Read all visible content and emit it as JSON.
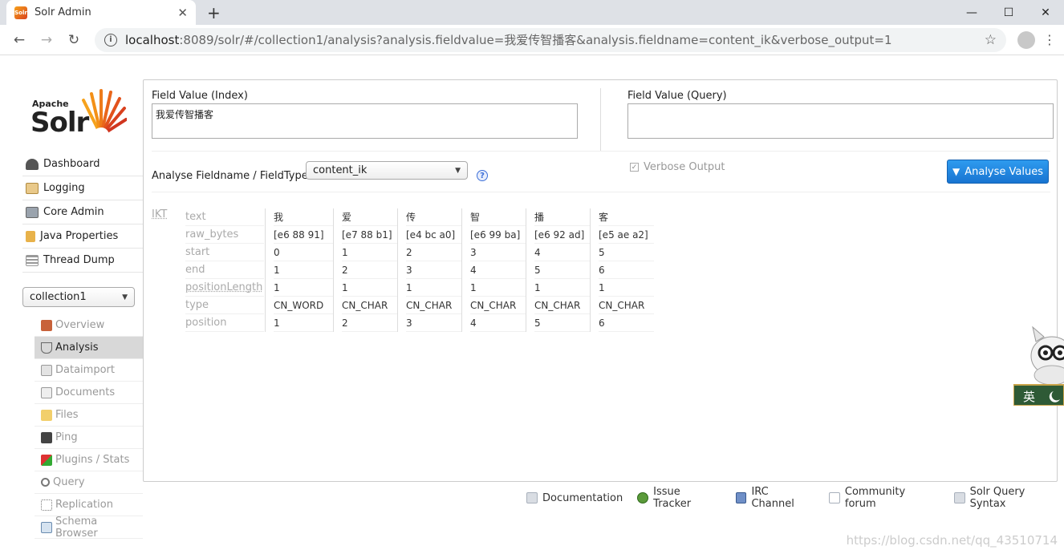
{
  "browser": {
    "tab_title": "Solr Admin",
    "favicon_text": "Solr",
    "url_host": "localhost",
    "url_rest": ":8089/solr/#/collection1/analysis?analysis.fieldvalue=我爱传智播客&analysis.fieldname=content_ik&verbose_output=1"
  },
  "logo": {
    "apache": "Apache",
    "solr": "Solr"
  },
  "nav": {
    "items": [
      {
        "label": "Dashboard",
        "icon": "dashboard-icon"
      },
      {
        "label": "Logging",
        "icon": "logging-icon"
      },
      {
        "label": "Core Admin",
        "icon": "core-admin-icon"
      },
      {
        "label": "Java Properties",
        "icon": "java-icon"
      },
      {
        "label": "Thread Dump",
        "icon": "thread-icon"
      }
    ],
    "core": "collection1",
    "subitems": [
      {
        "label": "Overview",
        "icon": "home-icon"
      },
      {
        "label": "Analysis",
        "icon": "filter-icon"
      },
      {
        "label": "Dataimport",
        "icon": "import-icon"
      },
      {
        "label": "Documents",
        "icon": "documents-icon"
      },
      {
        "label": "Files",
        "icon": "files-icon"
      },
      {
        "label": "Ping",
        "icon": "ping-icon"
      },
      {
        "label": "Plugins / Stats",
        "icon": "plugins-icon"
      },
      {
        "label": "Query",
        "icon": "query-icon"
      },
      {
        "label": "Replication",
        "icon": "replication-icon"
      },
      {
        "label": "Schema Browser",
        "icon": "schema-icon"
      }
    ]
  },
  "analysis": {
    "index_label": "Field Value (Index)",
    "index_value": "我爱传智播客",
    "query_label": "Field Value (Query)",
    "query_value": "",
    "fieldtype_label": "Analyse Fieldname / FieldType:",
    "fieldtype_value": "content_ik",
    "verbose_label": "Verbose Output",
    "button_label": "Analyse Values"
  },
  "result": {
    "stage": "IKT",
    "row_names": [
      "text",
      "raw_bytes",
      "start",
      "end",
      "positionLength",
      "type",
      "position"
    ],
    "tokens": [
      {
        "text": "我",
        "raw_bytes": "[e6 88 91]",
        "start": "0",
        "end": "1",
        "positionLength": "1",
        "type": "CN_WORD",
        "position": "1"
      },
      {
        "text": "爱",
        "raw_bytes": "[e7 88 b1]",
        "start": "1",
        "end": "2",
        "positionLength": "1",
        "type": "CN_CHAR",
        "position": "2"
      },
      {
        "text": "传",
        "raw_bytes": "[e4 bc a0]",
        "start": "2",
        "end": "3",
        "positionLength": "1",
        "type": "CN_CHAR",
        "position": "3"
      },
      {
        "text": "智",
        "raw_bytes": "[e6 99 ba]",
        "start": "3",
        "end": "4",
        "positionLength": "1",
        "type": "CN_CHAR",
        "position": "4"
      },
      {
        "text": "播",
        "raw_bytes": "[e6 92 ad]",
        "start": "4",
        "end": "5",
        "positionLength": "1",
        "type": "CN_CHAR",
        "position": "5"
      },
      {
        "text": "客",
        "raw_bytes": "[e5 ae a2]",
        "start": "5",
        "end": "6",
        "positionLength": "1",
        "type": "CN_CHAR",
        "position": "6"
      }
    ]
  },
  "footer": {
    "links": [
      "Documentation",
      "Issue Tracker",
      "IRC Channel",
      "Community forum",
      "Solr Query Syntax"
    ]
  },
  "watermark": "https://blog.csdn.net/qq_43510714",
  "mascot_text": "英",
  "colors": {
    "accent": "#1874d1",
    "active_nav": "#d8d8d8",
    "solr_orange": "#d9411e"
  }
}
